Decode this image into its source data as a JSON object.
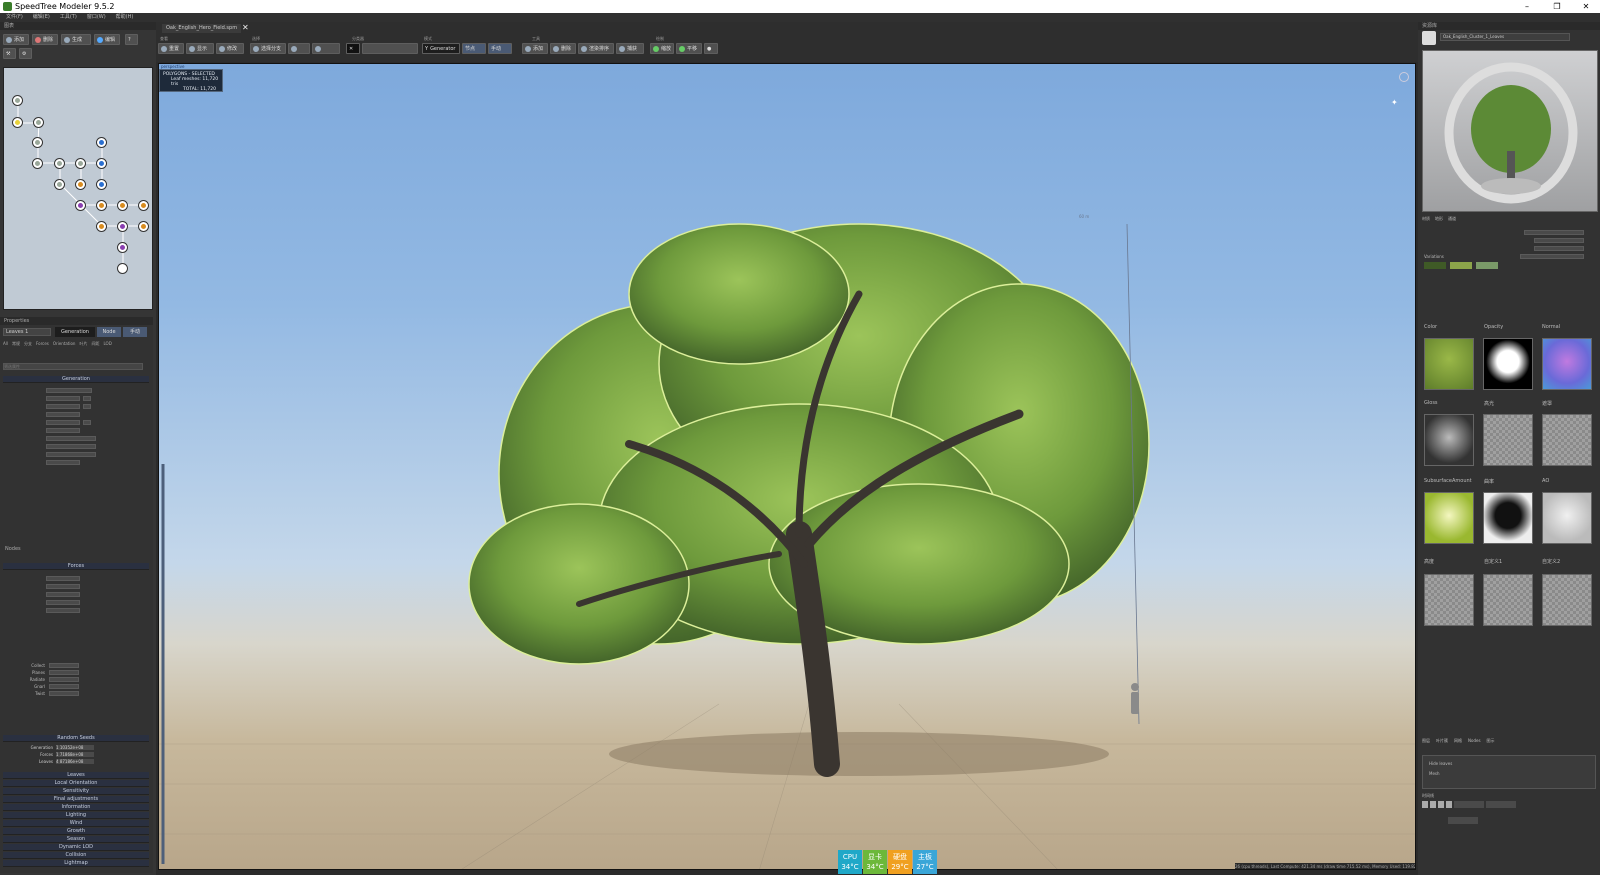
{
  "window": {
    "title": "SpeedTree  Modeler 9.5.2",
    "minimize": "–",
    "restore": "❐",
    "close": "✕"
  },
  "menu": [
    "文件(F)",
    "编辑(E)",
    "工具(T)",
    "窗口(W)",
    "帮助(H)"
  ],
  "file_tab": {
    "name": "Oak_English_Hero_Field.spm",
    "close": "✕"
  },
  "left_toolbar": {
    "b1": "添加",
    "b2": "删除",
    "b3": "生成",
    "b4": "编辑"
  },
  "graph_panel": {
    "label": "图表"
  },
  "properties": {
    "header": "Properties",
    "level_dropdown": "Leaves 1",
    "mode_tabs": [
      "Generation",
      "Node",
      "手动"
    ],
    "sub_tabs": [
      "All",
      "常规",
      "分支",
      "Forces",
      "Orientation",
      "叶片",
      "间距",
      "LOD"
    ],
    "filter_placeholder": "筛选属性",
    "section_generation": "Generation",
    "section_forces": "Forces",
    "section_random_seeds": "Random Seeds",
    "label_nodes": "Nodes",
    "forces_list": [
      "Collect",
      "Planes",
      "Radiate",
      "Gnarl",
      "Twist"
    ],
    "seeds": [
      {
        "label": "Generation",
        "value": "1 10352e+08"
      },
      {
        "label": "Forces",
        "value": "1 71868e+08"
      },
      {
        "label": "Leaves",
        "value": "4 87186e+08"
      }
    ],
    "collapsed_sections": [
      "Leaves",
      "Local Orientation",
      "Sensitivity",
      "Final adjustments",
      "Information",
      "Lighting",
      "Wind",
      "Growth",
      "Season",
      "Dynamic LOD",
      "Collision",
      "Lightmap"
    ]
  },
  "toolbar_groups": [
    "查看",
    "选择",
    "",
    "分类器",
    "",
    "模式",
    "",
    "工具",
    "",
    "绘制"
  ],
  "toolbar_buttons": [
    "重置",
    "显示",
    "修改",
    "选择分支",
    "生成器",
    "节点",
    "手动",
    "添加",
    "删除",
    "渲染排序",
    "捕获",
    "缩放",
    "平移"
  ],
  "mode_button": "Generator",
  "viewport": {
    "perspective_label": "perspective",
    "hud_line1": "POLYGONS - SELECTED",
    "hud_line2": "Leaf meshes: 11,720 tris",
    "hud_line3": "TOTAL: 11,720",
    "height_label": "60 m",
    "status_text": "26 (cpu threads), Last Compute: 421.34 ms (draw time 715.52 ms), Memory Used: 119.82"
  },
  "stats": [
    {
      "name": "CPU",
      "temp": "34°C",
      "color": "#1fa8c8"
    },
    {
      "name": "显卡",
      "temp": "34°C",
      "color": "#6cb83a"
    },
    {
      "name": "硬盘",
      "temp": "29°C",
      "color": "#f0a020"
    },
    {
      "name": "主板",
      "temp": "27°C",
      "color": "#3aa6d8"
    }
  ],
  "right_panel": {
    "header": "资源库",
    "preview_label": "材质预览",
    "material_dropdown": "Oak_English_Cluster_1_Leaves",
    "tabs": [
      "材质",
      "地形",
      "通道"
    ],
    "variations_label": "Variations",
    "variation_colors": [
      "#3f5a26",
      "#8ca54a",
      "#7a9a68"
    ],
    "map_headers": [
      "Color",
      "Opacity",
      "Normal",
      "Gloss",
      "高光",
      "遮罩",
      "SubsurfaceAmount",
      "曲率",
      "AO",
      "高度",
      "自定义1",
      "自定义2"
    ],
    "lower_tabs": [
      "图层",
      "叶片簇",
      "网格",
      "Nodes",
      "图示"
    ],
    "layers": [
      "Hide leaves",
      "Mesh"
    ],
    "anim_label": "时间线"
  },
  "colors": {
    "viewport_sky_top": "#7ea9dc",
    "ground": "#b8a68a",
    "accent": "#2a6fd0"
  }
}
